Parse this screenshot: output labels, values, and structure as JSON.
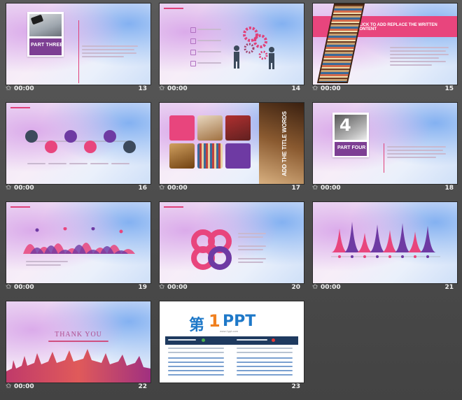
{
  "slides": [
    {
      "num": "13",
      "time": "00:00",
      "title": "PART THREE"
    },
    {
      "num": "14",
      "time": "00:00"
    },
    {
      "num": "15",
      "time": "00:00",
      "title": "CLICK TO ADD REPLACE THE WRITTEN CONTENT"
    },
    {
      "num": "16",
      "time": "00:00"
    },
    {
      "num": "17",
      "time": "00:00",
      "title": "ADD THE TITLE WORDS"
    },
    {
      "num": "18",
      "time": "00:00",
      "big_number": "4",
      "title": "PART FOUR"
    },
    {
      "num": "19",
      "time": "00:00"
    },
    {
      "num": "20",
      "time": "00:00"
    },
    {
      "num": "21",
      "time": "00:00"
    },
    {
      "num": "22",
      "time": "00:00",
      "title": "THANK YOU"
    },
    {
      "num": "23",
      "time": "00:00",
      "logo_cn": "第",
      "logo_digit": "1",
      "logo_ppt": "PPT",
      "logo_url": "www.1ppt.com"
    }
  ],
  "colors": {
    "pink": "#e8457d",
    "purple": "#6e3aa3",
    "navy": "#1e3a5f",
    "dark": "#3c4a5c"
  },
  "icons": {
    "footer": "star-icon"
  }
}
